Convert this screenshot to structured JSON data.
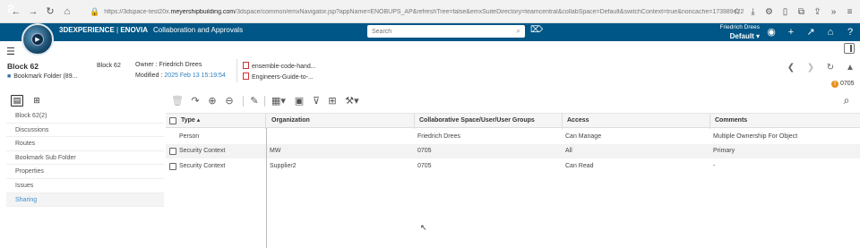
{
  "browser": {
    "url_prefix": "https://3dspace-test20x.",
    "url_host": "meyershipbuilding.com",
    "url_rest": "/3dspace/common/emxNavigator.jsp?appName=ENOBUPS_AP&refreshTree=false&emxSuiteDirectory=teamcentral&collabSpace=Default&switchContext=true&noncache=173989422"
  },
  "header": {
    "brand": "3DEXPERIENCE",
    "app_vendor": "ENOVIA",
    "app_name": "Collaboration and Approvals",
    "search_placeholder": "Search",
    "user_name": "Friedrich Drees",
    "collab_space": "Default",
    "accent": "#005686"
  },
  "object": {
    "name": "Block 62",
    "type_label": "Block 62",
    "folder": "Bookmark Folder (89...",
    "owner_label": "Owner :",
    "owner": "Friedrich Drees",
    "modified_label": "Modified :",
    "modified": "2025 Feb 13 15:19:54",
    "files": [
      "ensemble-code-hand...",
      "Engineers-Guide-to-..."
    ],
    "alert_count": "0705"
  },
  "left_nav": {
    "items": [
      {
        "label": "Block 62(2)"
      },
      {
        "label": "Discussions"
      },
      {
        "label": "Routes"
      },
      {
        "label": "Bookmark Sub Folder"
      },
      {
        "label": "Properties"
      },
      {
        "label": "Issues"
      },
      {
        "label": "Sharing",
        "active": true
      }
    ]
  },
  "table": {
    "columns": [
      "Type",
      "Organization",
      "Collaborative Space/User/User Groups",
      "Access",
      "Comments"
    ],
    "rows": [
      {
        "type": "Person",
        "organization": "",
        "space": "Friedrich Drees",
        "access": "Can Manage",
        "comments": "Multiple Ownership For Object"
      },
      {
        "type": "Security Context",
        "organization": "MW",
        "space": "0705",
        "access": "All",
        "comments": "Primary"
      },
      {
        "type": "Security Context",
        "organization": "Supplier2",
        "space": "0705",
        "access": "Can Read",
        "comments": "-"
      }
    ]
  }
}
